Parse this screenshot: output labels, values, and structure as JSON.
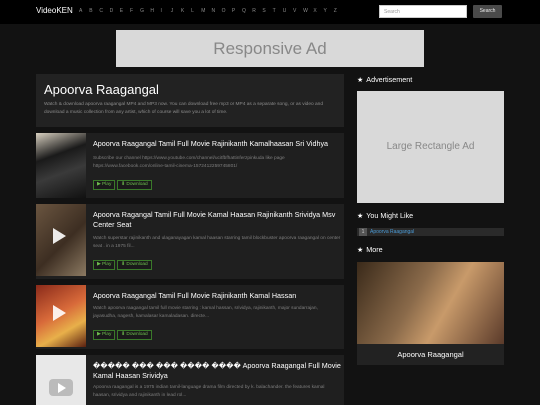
{
  "nav": {
    "brand": "VideoKEN",
    "letters": [
      "A",
      "B",
      "C",
      "D",
      "E",
      "F",
      "G",
      "H",
      "I",
      "J",
      "K",
      "L",
      "M",
      "N",
      "O",
      "P",
      "Q",
      "R",
      "S",
      "T",
      "U",
      "V",
      "W",
      "X",
      "Y",
      "Z"
    ],
    "search_placeholder": "Search",
    "search_button": "Search"
  },
  "top_ad": "Responsive Ad",
  "intro": {
    "title": "Apoorva Raagangal",
    "text": "Watch & download apoorva raagangal MP4 and MP3 now. You can download free mp3 or MP4 as a separate song, or as video and download a music collection from any artist, which of course will save you a lot of time."
  },
  "videos": [
    {
      "title": "Apoorva Raagangal Tamil Full Movie Rajinikanth Kamalhaasan Sri Vidhya",
      "desc": "Subscribe our channel https://www.youtube.com/channel/ucitfbfhattinferzpinkuda like page https://www.facebook.com/online-tamil-cinema-1572412259745801/",
      "play": "Play",
      "download": "Download"
    },
    {
      "title": "Apoorva Ragangal Tamil Full Movie Kamal Haasan Rajinikanth Srividya Msv Center Seat",
      "desc": "Watch superstar rajinikanth and ulaganayagan kamal haasan starring tamil blockbuster apoorva raagangal on center seat . in a 1975 fil...",
      "play": "Play",
      "download": "Download"
    },
    {
      "title": "Apoorva Raagangal Tamil Full Movie Rajinikanth Kamal Hassan",
      "desc": "Watch apoorva raagangal tamil full movie starring : kamal hassan, srividya, rajinikanth, major sundarrajan, jayasudha, nagesh, kamalasar kamaladasan. directe...",
      "play": "Play",
      "download": "Download"
    },
    {
      "title": "����� ��� ��� ���� ���� Apoorva Raagangal Full Movie Kamal Haasan Srividya",
      "desc": "Apoorva raagangal is a 1975 indian tamil-language drama film directed by k. balachander. the features kamal haasan, srividya and rajinikanth in lead rol..."
    }
  ],
  "sidebar": {
    "advertisement_heading": "Advertisement",
    "large_ad": "Large Rectangle Ad",
    "like_heading": "You Might Like",
    "like_items": [
      {
        "num": "1",
        "label": "Apoorva Raagangal"
      }
    ],
    "more_heading": "More",
    "more_caption": "Apoorva Raagangal"
  }
}
